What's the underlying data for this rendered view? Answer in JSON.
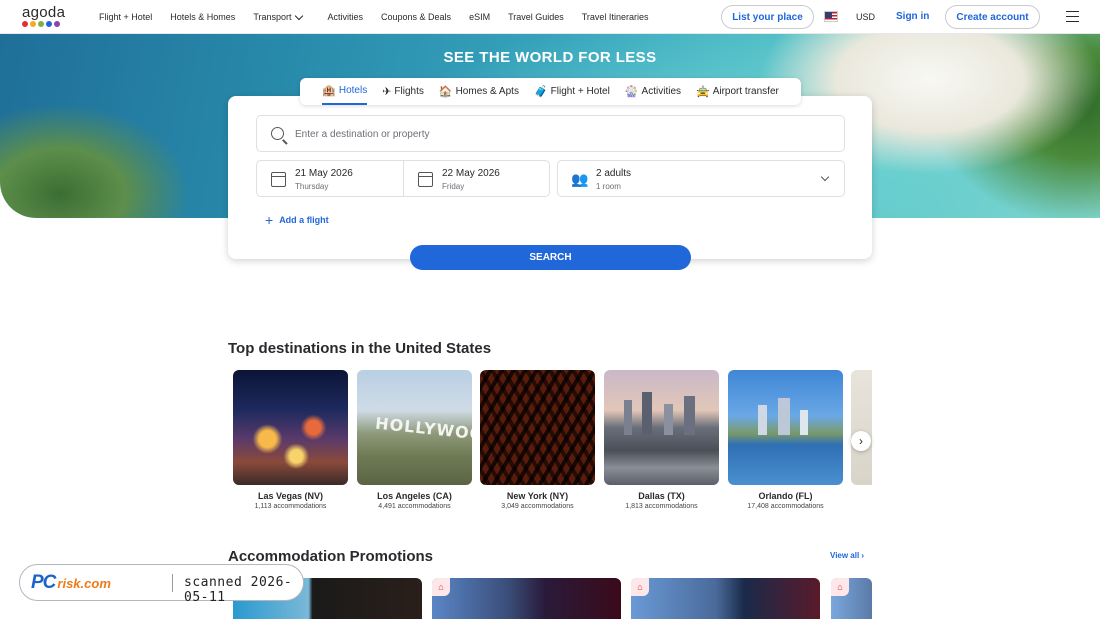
{
  "brand": {
    "name": "agoda",
    "dot_colors": [
      "#e12d39",
      "#f9a825",
      "#7cb342",
      "#2067da",
      "#8e44ad"
    ]
  },
  "nav": [
    {
      "label": "Flight + Hotel"
    },
    {
      "label": "Hotels & Homes"
    },
    {
      "label": "Transport",
      "dropdown": true
    },
    {
      "label": "Activities"
    },
    {
      "label": "Coupons & Deals"
    },
    {
      "label": "eSIM"
    },
    {
      "label": "Travel Guides"
    },
    {
      "label": "Travel Itineraries"
    }
  ],
  "header": {
    "list_place": "List your place",
    "currency": "USD",
    "sign_in": "Sign in",
    "create_account": "Create account"
  },
  "hero": {
    "title": "SEE THE WORLD FOR LESS"
  },
  "tabs": [
    {
      "label": "Hotels",
      "icon": "🏨"
    },
    {
      "label": "Flights",
      "icon": "✈"
    },
    {
      "label": "Homes & Apts",
      "icon": "🏠"
    },
    {
      "label": "Flight + Hotel",
      "icon": "🧳"
    },
    {
      "label": "Activities",
      "icon": "🎡"
    },
    {
      "label": "Airport transfer",
      "icon": "🚖"
    }
  ],
  "search": {
    "placeholder": "Enter a destination or property",
    "checkin": {
      "date": "21 May 2026",
      "day": "Thursday"
    },
    "checkout": {
      "date": "22 May 2026",
      "day": "Friday"
    },
    "guests": {
      "adults": "2 adults",
      "rooms": "1 room"
    },
    "add_flight": "Add a flight",
    "button": "SEARCH"
  },
  "top_destinations": {
    "title": "Top destinations in the United States",
    "cities": [
      {
        "name": "Las Vegas (NV)",
        "count": "1,113 accommodations"
      },
      {
        "name": "Los Angeles (CA)",
        "count": "4,491 accommodations"
      },
      {
        "name": "New York (NY)",
        "count": "3,049 accommodations"
      },
      {
        "name": "Dallas (TX)",
        "count": "1,813 accommodations"
      },
      {
        "name": "Orlando (FL)",
        "count": "17,408 accommodations"
      }
    ]
  },
  "promotions": {
    "title": "Accommodation Promotions",
    "view_all": "View all"
  },
  "watermark": {
    "logo_pc": "PC",
    "logo_risk": "risk.com",
    "scanned": "scanned 2026-05-11"
  }
}
